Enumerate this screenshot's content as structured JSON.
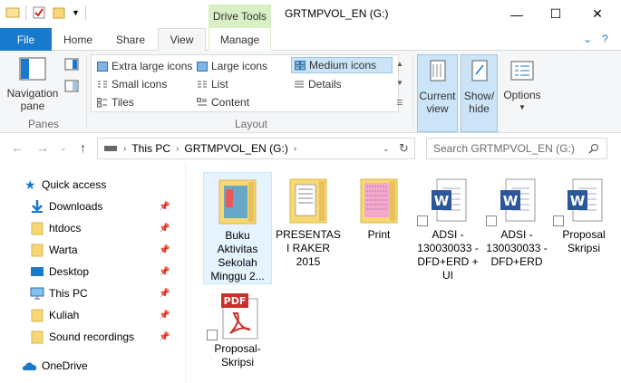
{
  "window": {
    "title": "GRTMPVOL_EN (G:)",
    "contextual_tab": "Drive Tools",
    "controls": {
      "minimize": "—",
      "maximize": "☐",
      "close": "✕"
    }
  },
  "tabs": [
    {
      "label": "File"
    },
    {
      "label": "Home"
    },
    {
      "label": "Share"
    },
    {
      "label": "View"
    },
    {
      "label": "Manage"
    }
  ],
  "ribbon": {
    "panes": {
      "nav_pane_label_1": "Navigation",
      "nav_pane_label_2": "pane",
      "group": "Panes"
    },
    "layout": {
      "group": "Layout",
      "options": [
        {
          "label": "Extra large icons"
        },
        {
          "label": "Large icons"
        },
        {
          "label": "Medium icons",
          "selected": true
        },
        {
          "label": "Small icons"
        },
        {
          "label": "List"
        },
        {
          "label": "Details"
        },
        {
          "label": "Tiles"
        },
        {
          "label": "Content"
        }
      ]
    },
    "current_view": {
      "line1": "Current",
      "line2": "view"
    },
    "show_hide": {
      "line1": "Show/",
      "line2": "hide"
    },
    "options": {
      "label": "Options"
    }
  },
  "address": {
    "crumbs": [
      "This PC",
      "GRTMPVOL_EN (G:)"
    ],
    "search_placeholder": "Search GRTMPVOL_EN (G:)"
  },
  "nav": {
    "quick_access": "Quick access",
    "items": [
      {
        "label": "Downloads"
      },
      {
        "label": "htdocs"
      },
      {
        "label": "Warta"
      },
      {
        "label": "Desktop"
      },
      {
        "label": "This PC"
      },
      {
        "label": "Kuliah"
      },
      {
        "label": "Sound recordings"
      }
    ],
    "onedrive": "OneDrive"
  },
  "files": [
    {
      "name": "Buku Aktivitas Sekolah Minggu 2...",
      "type": "folder"
    },
    {
      "name": "PRESENTASI RAKER 2015",
      "type": "folder"
    },
    {
      "name": "Print",
      "type": "folder"
    },
    {
      "name": "ADSI - 130030033 - DFD+ERD + UI",
      "type": "word-shortcut"
    },
    {
      "name": "ADSI - 130030033 - DFD+ERD",
      "type": "word-shortcut"
    },
    {
      "name": "Proposal Skripsi",
      "type": "word-shortcut"
    },
    {
      "name": "Proposal-Skripsi",
      "type": "pdf-shortcut"
    }
  ],
  "colors": {
    "accent": "#1979ca",
    "drive_tools": "#d9f0c4",
    "selection": "#cce4f7",
    "folder": "#f8d775"
  }
}
